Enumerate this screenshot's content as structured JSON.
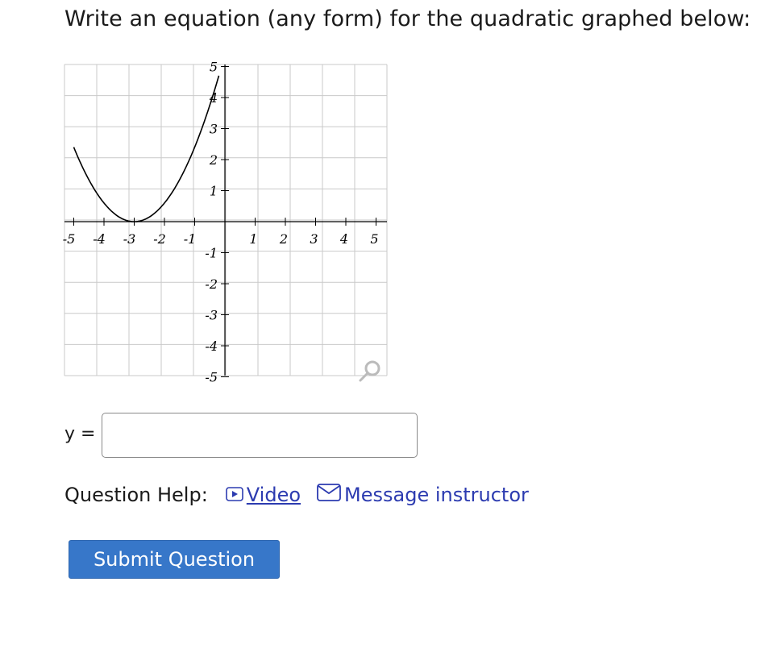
{
  "question": {
    "prompt": "Write an equation (any form) for the quadratic graphed below:"
  },
  "graph": {
    "x_tick_labels": [
      "-5",
      "-4",
      "-3",
      "-2",
      "-1",
      "1",
      "2",
      "3",
      "4",
      "5"
    ],
    "y_tick_labels": [
      "5",
      "4",
      "3",
      "2",
      "1",
      "-1",
      "-2",
      "-3",
      "-4",
      "-5"
    ],
    "zoom_icon": "magnifier-icon"
  },
  "chart_data": {
    "type": "line",
    "title": "",
    "xlabel": "",
    "ylabel": "",
    "xlim": [
      -5,
      5
    ],
    "ylim": [
      -5,
      5
    ],
    "grid": true,
    "curve": "parabola",
    "series": [
      {
        "x": [
          -5,
          -4,
          -3,
          -2,
          -1,
          -0.2
        ],
        "y": [
          2.4,
          0.6,
          0,
          0.6,
          2.4,
          4.9
        ]
      }
    ]
  },
  "answer": {
    "label": "y =",
    "value": "",
    "placeholder": ""
  },
  "help": {
    "label": "Question Help:",
    "video_label": " Video",
    "message_label": "Message instructor"
  },
  "submit_label": "Submit Question"
}
